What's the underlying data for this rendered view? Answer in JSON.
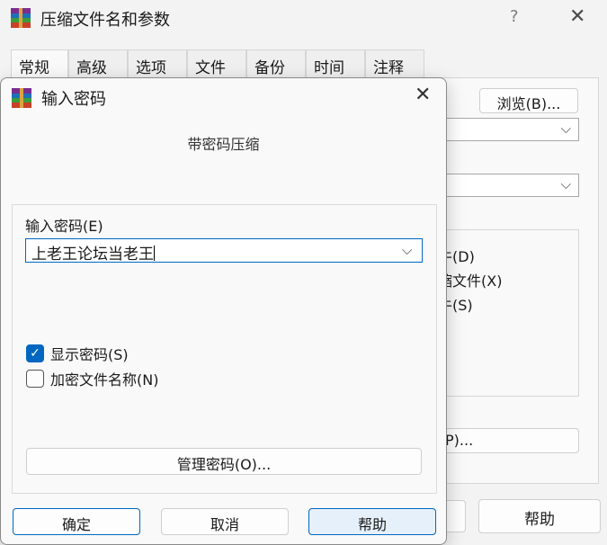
{
  "background_window": {
    "title": "压缩文件名和参数",
    "help_glyph": "?",
    "close_glyph": "✕",
    "tabs": [
      "常规",
      "高级",
      "选项",
      "文件",
      "备份",
      "时间",
      "注释"
    ],
    "browse_label": "浏览(B)...",
    "option_fragments": [
      "牛(D)",
      "缩文件(X)",
      "牛(S)"
    ],
    "partial_button_label": "P)...",
    "help_button_label": "帮助"
  },
  "dialog": {
    "title": "输入密码",
    "close_glyph": "✕",
    "heading": "带密码压缩",
    "password_label": "输入密码(E)",
    "password_value": "上老王论坛当老王",
    "show_password_label": "显示密码(S)",
    "show_password_checked": true,
    "encrypt_names_label": "加密文件名称(N)",
    "encrypt_names_checked": false,
    "manage_label": "管理密码(O)...",
    "ok_label": "确定",
    "cancel_label": "取消",
    "help_label": "帮助"
  },
  "icons": {
    "dropdown": "⌵",
    "check": "✓"
  },
  "colors": {
    "accent": "#0067c0",
    "window_bg": "#f3f3f3",
    "panel_bg": "#f9f9f9"
  }
}
